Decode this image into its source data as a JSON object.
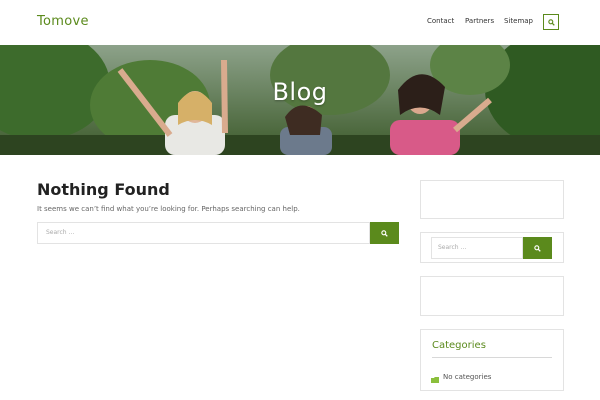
{
  "header": {
    "logo": "Tomove",
    "nav": [
      "Contact",
      "Partners",
      "Sitemap"
    ],
    "search_icon": "search-icon"
  },
  "hero": {
    "title": "Blog"
  },
  "main": {
    "title": "Nothing Found",
    "message": "It seems we can’t find what you’re looking for. Perhaps searching can help.",
    "search": {
      "placeholder": "Search …",
      "button_icon": "search-icon"
    }
  },
  "sidebar": {
    "search": {
      "placeholder": "Search …",
      "button_icon": "search-icon"
    },
    "categories": {
      "title": "Categories",
      "items": [
        "No categories"
      ]
    }
  },
  "colors": {
    "accent": "#5b8a1c",
    "border": "#e3e3e3",
    "text": "#333333"
  }
}
